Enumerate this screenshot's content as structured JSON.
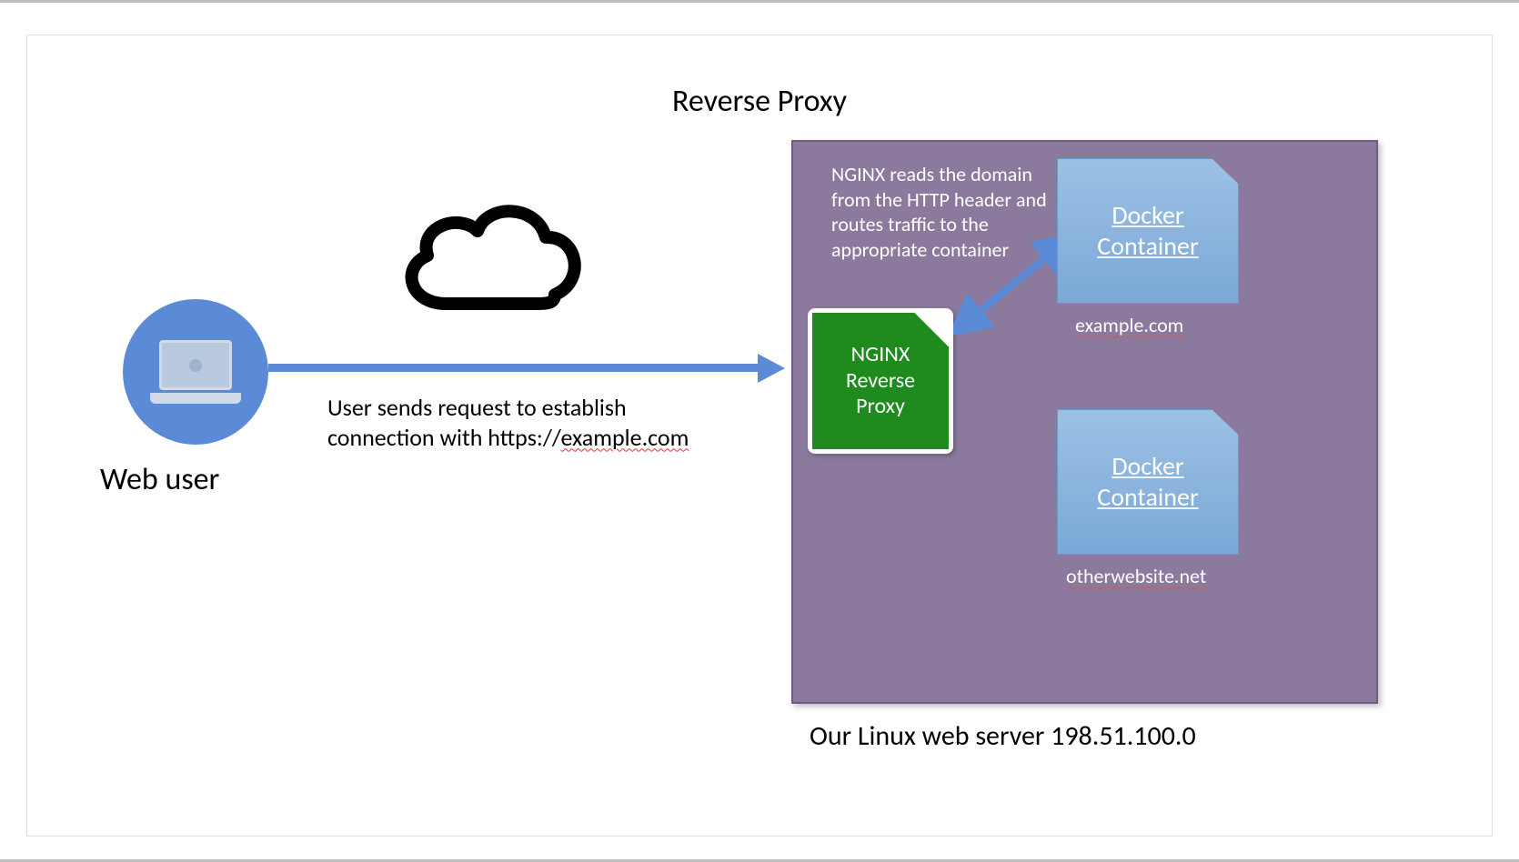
{
  "title": "Reverse Proxy",
  "user_label": "Web user",
  "request_caption_line1": "User sends request to establish",
  "request_caption_line2_prefix": "connection with https://",
  "request_caption_domain": "example.com",
  "server": {
    "nginx_description": "NGINX reads the domain from the HTTP header and routes traffic to the appropriate container",
    "nginx_label_line1": "NGINX",
    "nginx_label_line2": "Reverse",
    "nginx_label_line3": "Proxy",
    "docker1_line1": "Docker",
    "docker1_line2": "Container",
    "docker1_caption": "example.com",
    "docker2_line1": "Docker",
    "docker2_line2": "Container",
    "docker2_caption": "otherwebsite.net",
    "caption": "Our Linux web server 198.51.100.0"
  }
}
